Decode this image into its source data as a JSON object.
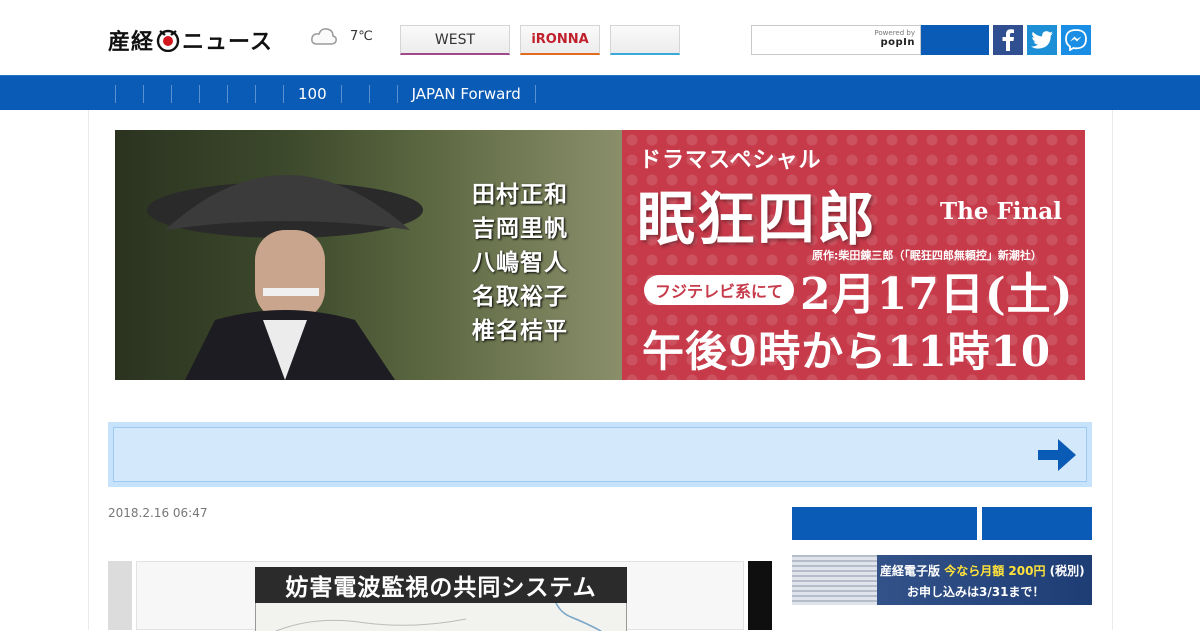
{
  "header": {
    "logo_text_left": "産経",
    "logo_text_right": "ニュース",
    "weather": {
      "icon": "cloud-icon",
      "temperature": "7℃"
    },
    "site_tabs": [
      {
        "label": "WEST",
        "accent": "#a04a8c"
      },
      {
        "label": "iRONNA",
        "accent": "#e26a1e"
      },
      {
        "label": "",
        "accent": "#3aa8d8"
      }
    ],
    "search": {
      "placeholder": "",
      "powered_by": "Powered by",
      "powered_brand": "popIn"
    },
    "sns": [
      "facebook-icon",
      "twitter-icon",
      "messenger-icon"
    ]
  },
  "nav": {
    "items": [
      "",
      "",
      "",
      "",
      "",
      "",
      "",
      "100",
      "",
      "",
      "JAPAN Forward"
    ]
  },
  "banner": {
    "cast": [
      "田村正和",
      "吉岡里帆",
      "八嶋智人",
      "名取裕子",
      "椎名桔平"
    ],
    "drama_special": "ドラマスペシャル",
    "title": "眠狂四郎",
    "title_suffix": "The Final",
    "original": "原作:柴田錬三郎（「眠狂四郎無頼控」新潮社）",
    "network": "フジテレビ系にて",
    "date": "2月17日(土)",
    "time": "午後9時から11時10分"
  },
  "article": {
    "date": "2018.2.16 06:47",
    "image_title": "妨害電波監視の共同システム"
  },
  "sidebar_ad": {
    "line1_a": "産経電子版",
    "line1_b": "今なら月額",
    "line1_price": "200円",
    "line1_tax": "(税別)",
    "line2": "お申し込みは3/31まで！"
  },
  "colors": {
    "brand_blue": "#0a5bb5",
    "banner_red": "#c63a4a",
    "bar_light_blue": "#c7e2fb"
  }
}
